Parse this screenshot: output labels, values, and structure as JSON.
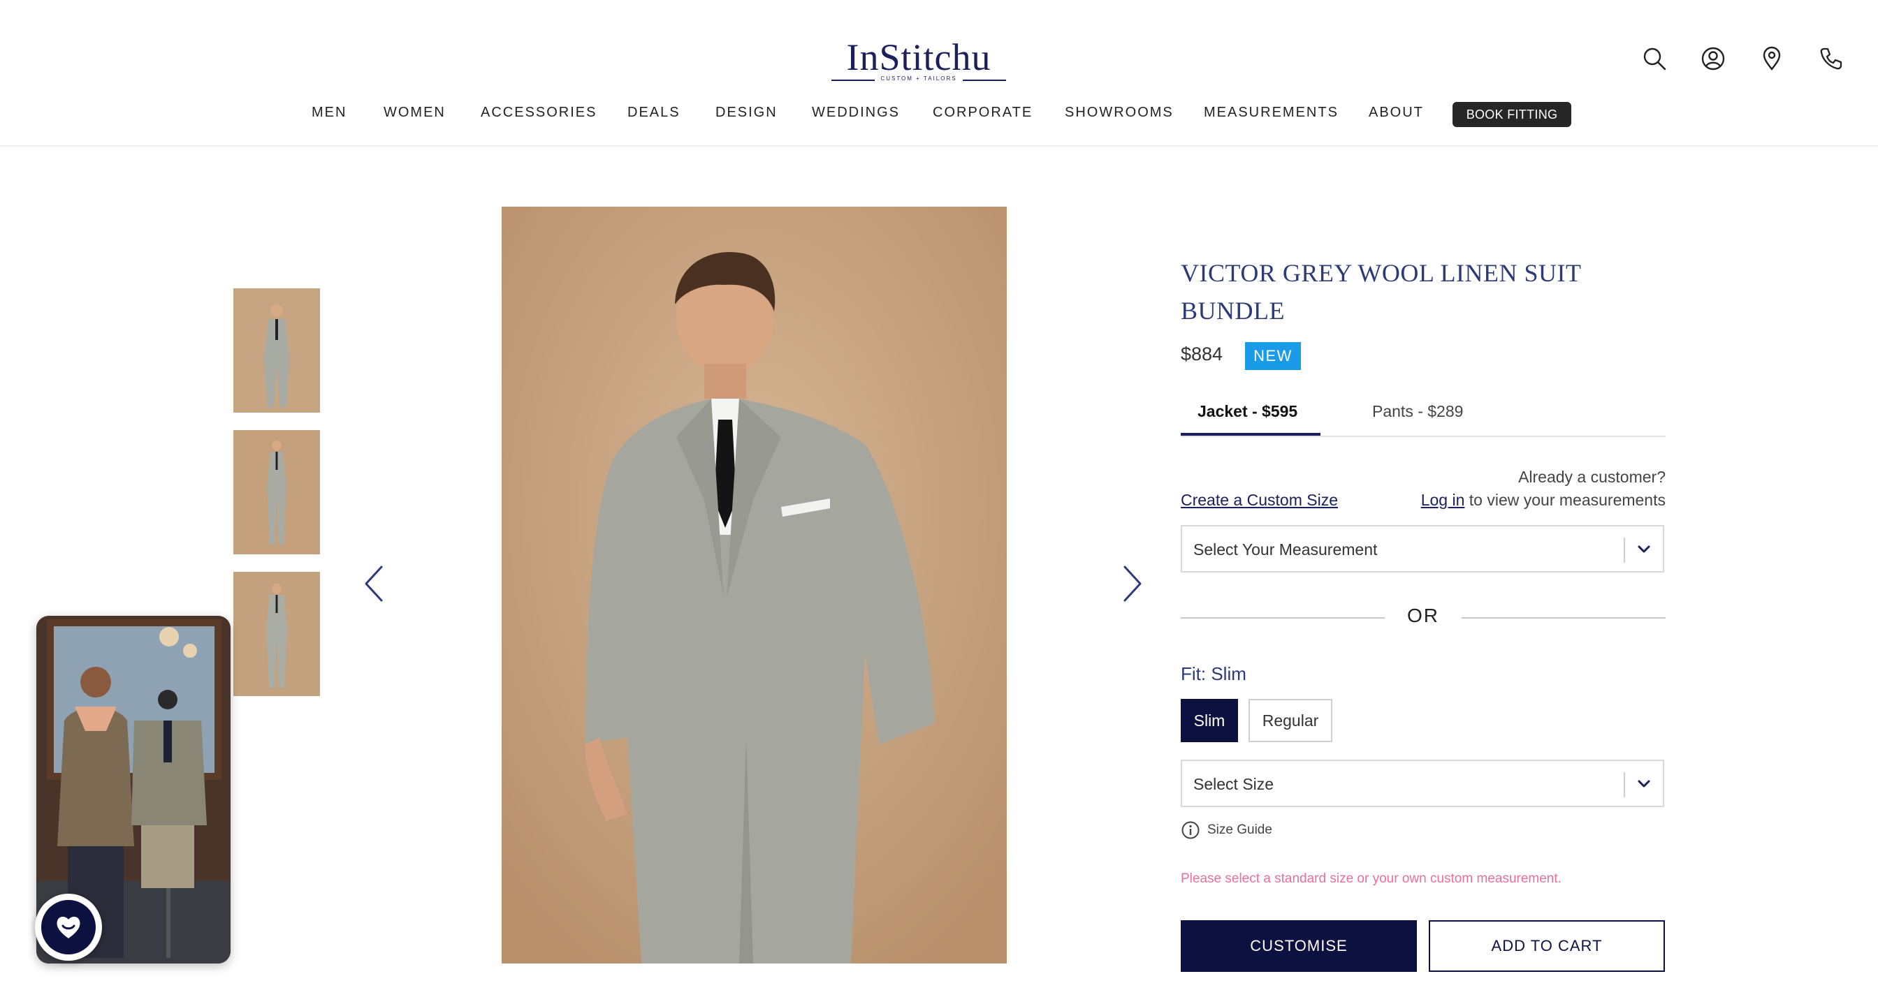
{
  "header": {
    "logo_text": "InStitchu",
    "logo_tagline": "CUSTOM + TAILORS",
    "icons": [
      "search-icon",
      "account-icon",
      "location-icon",
      "phone-icon"
    ],
    "nav": [
      "MEN",
      "WOMEN",
      "ACCESSORIES",
      "DEALS",
      "DESIGN",
      "WEDDINGS",
      "CORPORATE",
      "SHOWROOMS",
      "MEASUREMENTS",
      "ABOUT"
    ],
    "book_fitting": "BOOK FITTING"
  },
  "product": {
    "title": "VICTOR GREY WOOL LINEN SUIT BUNDLE",
    "price": "$884",
    "badge": "NEW",
    "tabs": [
      {
        "label": "Jacket - $595",
        "active": true
      },
      {
        "label": "Pants - $289",
        "active": false
      }
    ],
    "already_customer": "Already a customer?",
    "create_custom_size": "Create a Custom Size",
    "login_link": "Log in",
    "login_suffix": " to view your measurements",
    "measurement_placeholder": "Select Your Measurement",
    "or_text": "OR",
    "fit_label": "Fit: Slim",
    "fit_options": [
      {
        "label": "Slim",
        "selected": true
      },
      {
        "label": "Regular",
        "selected": false
      }
    ],
    "size_placeholder": "Select Size",
    "size_guide": "Size Guide",
    "warning": "Please select a standard size or your own custom measurement.",
    "customise_label": "CUSTOMISE",
    "add_to_cart_label": "ADD TO CART"
  },
  "colors": {
    "brand_navy": "#0d1140",
    "title_blue": "#2d3a78",
    "badge_blue": "#1a9be8",
    "warning_pink": "#e8709a"
  }
}
